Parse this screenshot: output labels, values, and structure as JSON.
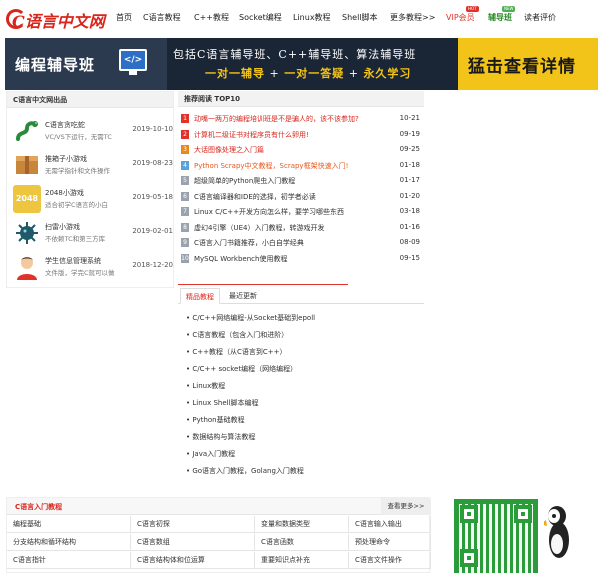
{
  "header": {
    "logo_text": "C语言中文网",
    "nav": [
      {
        "label": "首页",
        "style": "normal"
      },
      {
        "label": "C语言教程",
        "style": "normal"
      },
      {
        "label": "C++教程",
        "style": "normal"
      },
      {
        "label": "Socket编程",
        "style": "normal"
      },
      {
        "label": "Linux教程",
        "style": "normal"
      },
      {
        "label": "Shell脚本",
        "style": "normal"
      },
      {
        "label": "更多教程>>",
        "style": "normal"
      },
      {
        "label": "VIP会员",
        "style": "vip"
      },
      {
        "label": "辅导班",
        "style": "fd"
      },
      {
        "label": "读者评价",
        "style": "normal"
      }
    ],
    "badge_hot": "HOT",
    "badge_new": "NEW"
  },
  "banner": {
    "title": "编程辅导班",
    "monitor_glyph": "</>",
    "line1": "包括C语言辅导班、C++辅导班、算法辅导班",
    "line2_a": "一对一辅导",
    "line2_b": " + ",
    "line2_c": "一对一答疑",
    "line2_d": " + ",
    "line2_e": "永久学习",
    "cta": "猛击查看详情",
    "colors": {
      "bg": "#1a2535",
      "cta": "#f2c318",
      "accent": "#f5c518"
    }
  },
  "apps": {
    "title": "C语言中文网出品",
    "items": [
      {
        "name": "C语言贪吃蛇",
        "desc": "VC/VS下运行，无需TC",
        "date": "2019-10-10",
        "icon": "snake-icon"
      },
      {
        "name": "推箱子小游戏",
        "desc": "无需学指针和文件操作",
        "date": "2019-08-23",
        "icon": "box-icon"
      },
      {
        "name": "2048小游戏",
        "desc": "适合初学C语言的小白",
        "date": "2019-05-18",
        "icon": "game-2048-icon",
        "icon_text": "2048"
      },
      {
        "name": "扫雷小游戏",
        "desc": "不依赖TC和第三方库",
        "date": "2019-02-01",
        "icon": "mine-icon"
      },
      {
        "name": "学生信息管理系统",
        "desc": "文件版，学完C就可以做",
        "date": "2018-12-20",
        "icon": "student-icon"
      }
    ]
  },
  "top10": {
    "title": "推荐阅读 TOP10",
    "items": [
      {
        "num": "1",
        "title": "动嘴一两万的编程培训班是不是骗人的，该不该参加?",
        "date": "10-21",
        "color": "red",
        "num_style": "hot"
      },
      {
        "num": "2",
        "title": "计算机二级证书对程序员有什么卵用!",
        "date": "09-19",
        "color": "red",
        "num_style": "hot"
      },
      {
        "num": "3",
        "title": "大话图像处理之入门篇",
        "date": "09-25",
        "color": "red",
        "num_style": "warm"
      },
      {
        "num": "4",
        "title": "Python Scrapy中文教程，Scrapy框架快速入门!",
        "date": "01-18",
        "color": "orange",
        "num_style": "mid"
      },
      {
        "num": "5",
        "title": "超级简单的Python爬虫入门教程",
        "date": "01-17",
        "color": "normal",
        "num_style": "normal"
      },
      {
        "num": "6",
        "title": "C语言编译器和IDE的选择，初学者必读",
        "date": "01-20",
        "color": "normal",
        "num_style": "normal"
      },
      {
        "num": "7",
        "title": "Linux C/C++开发方向怎么样，要学习哪些东西",
        "date": "03-18",
        "color": "normal",
        "num_style": "normal"
      },
      {
        "num": "8",
        "title": "虚幻4引擎（UE4）入门教程，转游戏开发",
        "date": "01-16",
        "color": "normal",
        "num_style": "normal"
      },
      {
        "num": "9",
        "title": "C语言入门书籍推荐，小白自学经典",
        "date": "08-09",
        "color": "normal",
        "num_style": "normal"
      },
      {
        "num": "10",
        "title": "MySQL Workbench使用教程",
        "date": "09-15",
        "color": "normal",
        "num_style": "normal"
      }
    ]
  },
  "tabs": [
    {
      "label": "精品教程",
      "active": true
    },
    {
      "label": "最近更新",
      "active": false
    }
  ],
  "tutorials": [
    "• C/C++网络编程-从Socket基础到epoll",
    "• C语言教程（包含入门和进阶）",
    "• C++教程（从C语言到C++）",
    "• C/C++ socket编程（网络编程）",
    "• Linux教程",
    "• Linux Shell脚本编程",
    "• Python基础教程",
    "• 数据结构与算法教程",
    "• Java入门教程",
    "• Go语言入门教程，Golang入门教程"
  ],
  "course": {
    "title": "C语言入门教程",
    "more": "查看更多>>",
    "rows": [
      [
        "编程基础",
        "C语言初探",
        "变量和数据类型",
        "C语言输入输出"
      ],
      [
        "分支结构和循环结构",
        "C语言数组",
        "C语言函数",
        "预处理命令"
      ],
      [
        "C语言指针",
        "C语言结构体和位运算",
        "重要知识点补充",
        "C语言文件操作"
      ]
    ]
  }
}
